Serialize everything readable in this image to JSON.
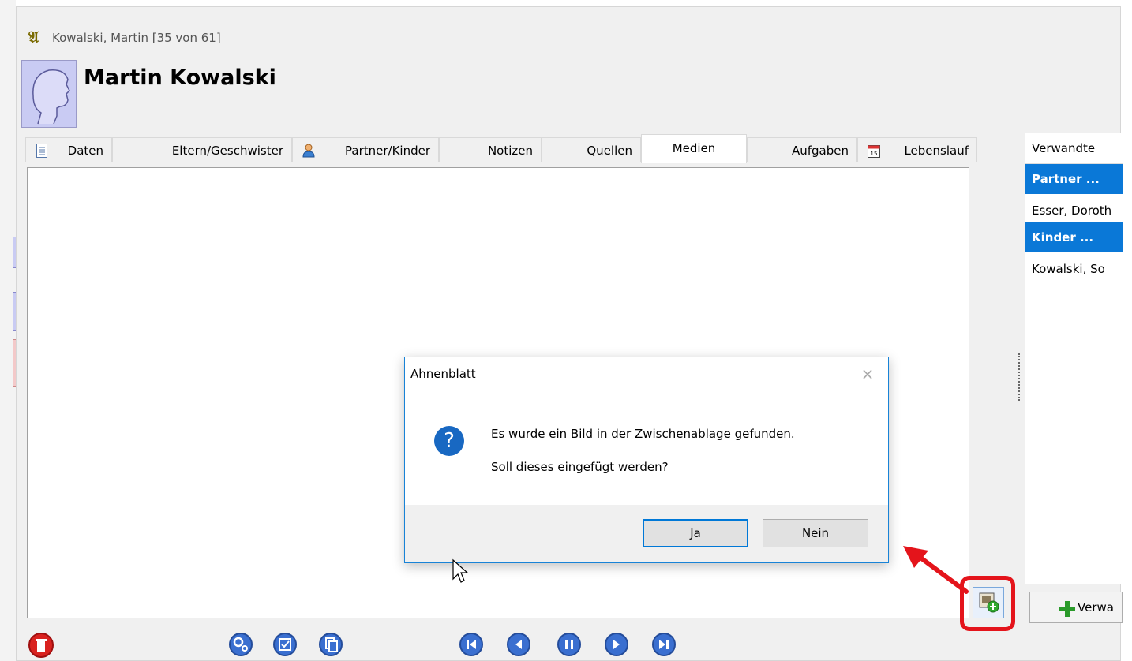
{
  "window": {
    "title": "Kowalski, Martin [35 von 61]",
    "person_name": "Martin Kowalski"
  },
  "tabs": [
    {
      "label": "Daten",
      "icon": "document-icon"
    },
    {
      "label": "Eltern/Geschwister",
      "icon": ""
    },
    {
      "label": "Partner/Kinder",
      "icon": "person-icon"
    },
    {
      "label": "Notizen",
      "icon": ""
    },
    {
      "label": "Quellen",
      "icon": ""
    },
    {
      "label": "Medien",
      "icon": "",
      "active": true
    },
    {
      "label": "Aufgaben",
      "icon": ""
    },
    {
      "label": "Lebenslauf",
      "icon": "calendar-icon"
    }
  ],
  "relatives_panel": {
    "header": "Verwandte",
    "rows": [
      {
        "label": "Partner ...",
        "type": "section"
      },
      {
        "label": "Esser, Doroth",
        "type": "item"
      },
      {
        "label": "Kinder ...",
        "type": "section"
      },
      {
        "label": "Kowalski, So",
        "type": "item"
      }
    ],
    "add_button_label": "Verwa"
  },
  "dialog": {
    "title": "Ahnenblatt",
    "close_symbol": "×",
    "message_line1": "Es wurde ein Bild in der Zwischenablage gefunden.",
    "message_line2": "Soll dieses eingefügt werden?",
    "icon": "question-icon",
    "icon_glyph": "?",
    "yes_label": "Ja",
    "no_label": "Nein"
  },
  "colors": {
    "selection_blue": "#0a78d7",
    "highlight_red": "#e4141b",
    "dialog_border": "#1883d7"
  }
}
